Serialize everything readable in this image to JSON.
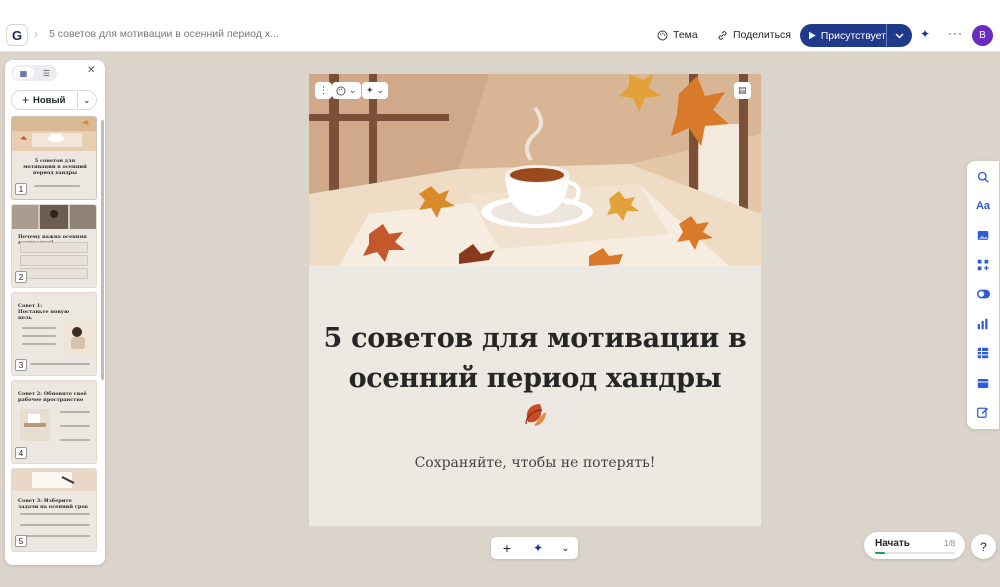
{
  "topbar": {
    "logo": "G",
    "doc_title": "5 советов для мотивации в осенний период х...",
    "theme_label": "Тема",
    "share_label": "Поделиться",
    "present_label": "Присутствует",
    "avatar_initial": "B"
  },
  "left_panel": {
    "new_label": "Новый",
    "thumbnails": [
      {
        "number": "1",
        "title": "5 советов для мотивации в осенний период хандры"
      },
      {
        "number": "2",
        "title": "Почему важна осенняя мотивация?"
      },
      {
        "number": "3",
        "title": "Совет 1: Поставьте новую цель"
      },
      {
        "number": "4",
        "title": "Совет 2: Обновите своё рабочее пространство"
      },
      {
        "number": "5",
        "title": "Совет 3: Изберите задачи на осенний срок"
      }
    ]
  },
  "slide": {
    "title": "5 советов для мотивации в осенний период хандры",
    "subtitle": "Сохраняйте, чтобы не потерять!"
  },
  "start_widget": {
    "label": "Начать",
    "count": "1/8",
    "progress": 0.125
  },
  "help_label": "?",
  "colors": {
    "accent": "#1f3a8a",
    "avatar": "#6a2bbf",
    "canvas": "#dbd4cb",
    "progress": "#1aa34a"
  }
}
